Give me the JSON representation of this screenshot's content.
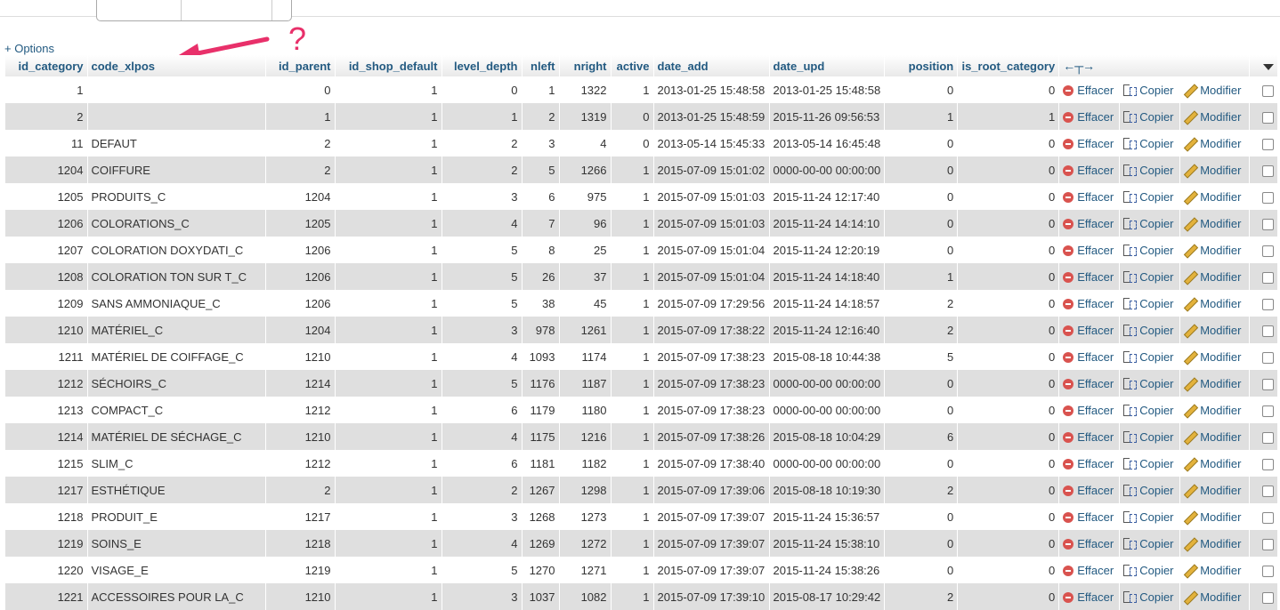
{
  "options_link": "+ Options",
  "annotation": {
    "question_mark": "?",
    "color": "#e8306a"
  },
  "columns": {
    "id_category": "id_category",
    "code_xlpos": "code_xlpos",
    "id_parent": "id_parent",
    "id_shop_default": "id_shop_default",
    "level_depth": "level_depth",
    "nleft": "nleft",
    "nright": "nright",
    "active": "active",
    "date_add": "date_add",
    "date_upd": "date_upd",
    "position": "position",
    "is_root_category": "is_root_category",
    "resize_arrows": "←┬→"
  },
  "actions": {
    "delete": "Effacer",
    "copy": "Copier",
    "edit": "Modifier"
  },
  "rows": [
    {
      "id": "1",
      "code": "",
      "parent": "0",
      "shop": "1",
      "depth": "0",
      "nleft": "1",
      "nright": "1322",
      "active": "1",
      "date_add": "2013-01-25 15:48:58",
      "date_upd": "2013-01-25 15:48:58",
      "position": "0",
      "is_root": "0"
    },
    {
      "id": "2",
      "code": "",
      "parent": "1",
      "shop": "1",
      "depth": "1",
      "nleft": "2",
      "nright": "1319",
      "active": "0",
      "date_add": "2013-01-25 15:48:59",
      "date_upd": "2015-11-26 09:56:53",
      "position": "1",
      "is_root": "1"
    },
    {
      "id": "11",
      "code": "DEFAUT",
      "parent": "2",
      "shop": "1",
      "depth": "2",
      "nleft": "3",
      "nright": "4",
      "active": "0",
      "date_add": "2013-05-14 15:45:33",
      "date_upd": "2013-05-14 16:45:48",
      "position": "0",
      "is_root": "0"
    },
    {
      "id": "1204",
      "code": "COIFFURE",
      "parent": "2",
      "shop": "1",
      "depth": "2",
      "nleft": "5",
      "nright": "1266",
      "active": "1",
      "date_add": "2015-07-09 15:01:02",
      "date_upd": "0000-00-00 00:00:00",
      "position": "0",
      "is_root": "0"
    },
    {
      "id": "1205",
      "code": "PRODUITS_C",
      "parent": "1204",
      "shop": "1",
      "depth": "3",
      "nleft": "6",
      "nright": "975",
      "active": "1",
      "date_add": "2015-07-09 15:01:03",
      "date_upd": "2015-11-24 12:17:40",
      "position": "0",
      "is_root": "0"
    },
    {
      "id": "1206",
      "code": "COLORATIONS_C",
      "parent": "1205",
      "shop": "1",
      "depth": "4",
      "nleft": "7",
      "nright": "96",
      "active": "1",
      "date_add": "2015-07-09 15:01:03",
      "date_upd": "2015-11-24 14:14:10",
      "position": "0",
      "is_root": "0"
    },
    {
      "id": "1207",
      "code": "COLORATION DOXYDATI_C",
      "parent": "1206",
      "shop": "1",
      "depth": "5",
      "nleft": "8",
      "nright": "25",
      "active": "1",
      "date_add": "2015-07-09 15:01:04",
      "date_upd": "2015-11-24 12:20:19",
      "position": "0",
      "is_root": "0"
    },
    {
      "id": "1208",
      "code": "COLORATION TON SUR T_C",
      "parent": "1206",
      "shop": "1",
      "depth": "5",
      "nleft": "26",
      "nright": "37",
      "active": "1",
      "date_add": "2015-07-09 15:01:04",
      "date_upd": "2015-11-24 14:18:40",
      "position": "1",
      "is_root": "0"
    },
    {
      "id": "1209",
      "code": "SANS AMMONIAQUE_C",
      "parent": "1206",
      "shop": "1",
      "depth": "5",
      "nleft": "38",
      "nright": "45",
      "active": "1",
      "date_add": "2015-07-09 17:29:56",
      "date_upd": "2015-11-24 14:18:57",
      "position": "2",
      "is_root": "0"
    },
    {
      "id": "1210",
      "code": "MATÉRIEL_C",
      "parent": "1204",
      "shop": "1",
      "depth": "3",
      "nleft": "978",
      "nright": "1261",
      "active": "1",
      "date_add": "2015-07-09 17:38:22",
      "date_upd": "2015-11-24 12:16:40",
      "position": "2",
      "is_root": "0"
    },
    {
      "id": "1211",
      "code": "MATÉRIEL DE COIFFAGE_C",
      "parent": "1210",
      "shop": "1",
      "depth": "4",
      "nleft": "1093",
      "nright": "1174",
      "active": "1",
      "date_add": "2015-07-09 17:38:23",
      "date_upd": "2015-08-18 10:44:38",
      "position": "5",
      "is_root": "0"
    },
    {
      "id": "1212",
      "code": "SÉCHOIRS_C",
      "parent": "1214",
      "shop": "1",
      "depth": "5",
      "nleft": "1176",
      "nright": "1187",
      "active": "1",
      "date_add": "2015-07-09 17:38:23",
      "date_upd": "0000-00-00 00:00:00",
      "position": "0",
      "is_root": "0"
    },
    {
      "id": "1213",
      "code": "COMPACT_C",
      "parent": "1212",
      "shop": "1",
      "depth": "6",
      "nleft": "1179",
      "nright": "1180",
      "active": "1",
      "date_add": "2015-07-09 17:38:23",
      "date_upd": "0000-00-00 00:00:00",
      "position": "0",
      "is_root": "0"
    },
    {
      "id": "1214",
      "code": "MATÉRIEL DE SÉCHAGE_C",
      "parent": "1210",
      "shop": "1",
      "depth": "4",
      "nleft": "1175",
      "nright": "1216",
      "active": "1",
      "date_add": "2015-07-09 17:38:26",
      "date_upd": "2015-08-18 10:04:29",
      "position": "6",
      "is_root": "0"
    },
    {
      "id": "1215",
      "code": "SLIM_C",
      "parent": "1212",
      "shop": "1",
      "depth": "6",
      "nleft": "1181",
      "nright": "1182",
      "active": "1",
      "date_add": "2015-07-09 17:38:40",
      "date_upd": "0000-00-00 00:00:00",
      "position": "0",
      "is_root": "0"
    },
    {
      "id": "1217",
      "code": "ESTHÉTIQUE",
      "parent": "2",
      "shop": "1",
      "depth": "2",
      "nleft": "1267",
      "nright": "1298",
      "active": "1",
      "date_add": "2015-07-09 17:39:06",
      "date_upd": "2015-08-18 10:19:30",
      "position": "2",
      "is_root": "0"
    },
    {
      "id": "1218",
      "code": "PRODUIT_E",
      "parent": "1217",
      "shop": "1",
      "depth": "3",
      "nleft": "1268",
      "nright": "1273",
      "active": "1",
      "date_add": "2015-07-09 17:39:07",
      "date_upd": "2015-11-24 15:36:57",
      "position": "0",
      "is_root": "0"
    },
    {
      "id": "1219",
      "code": "SOINS_E",
      "parent": "1218",
      "shop": "1",
      "depth": "4",
      "nleft": "1269",
      "nright": "1272",
      "active": "1",
      "date_add": "2015-07-09 17:39:07",
      "date_upd": "2015-11-24 15:38:10",
      "position": "0",
      "is_root": "0"
    },
    {
      "id": "1220",
      "code": "VISAGE_E",
      "parent": "1219",
      "shop": "1",
      "depth": "5",
      "nleft": "1270",
      "nright": "1271",
      "active": "1",
      "date_add": "2015-07-09 17:39:07",
      "date_upd": "2015-11-24 15:38:26",
      "position": "0",
      "is_root": "0"
    },
    {
      "id": "1221",
      "code": "ACCESSOIRES POUR LA_C",
      "parent": "1210",
      "shop": "1",
      "depth": "3",
      "nleft": "1037",
      "nright": "1082",
      "active": "1",
      "date_add": "2015-07-09 17:39:10",
      "date_upd": "2015-08-17 10:29:42",
      "position": "2",
      "is_root": "0"
    }
  ]
}
